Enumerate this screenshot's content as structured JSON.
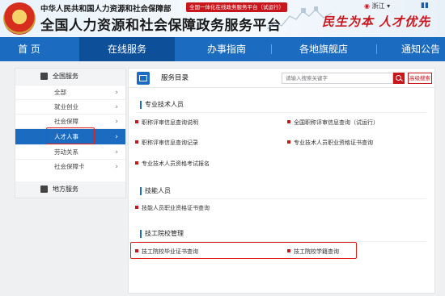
{
  "header": {
    "org_name": "中华人民共和国人力资源和社会保障部",
    "org_tag": "全国一体化在线政务服务平台（试运行）",
    "site_title": "全国人力资源和社会保障政务服务平台",
    "region": "浙江",
    "slogan": "民生为本 人才优先"
  },
  "nav": {
    "items": [
      {
        "label": "首 页"
      },
      {
        "label": "在线服务"
      },
      {
        "label": "办事指南"
      },
      {
        "label": "各地旗舰店"
      },
      {
        "label": "通知公告"
      }
    ]
  },
  "sidebar": {
    "national_label": "全国服务",
    "items": [
      {
        "label": "全部"
      },
      {
        "label": "就业创业"
      },
      {
        "label": "社会保障"
      },
      {
        "label": "人才人事"
      },
      {
        "label": "劳动关系"
      },
      {
        "label": "社会保障卡"
      }
    ],
    "active_item": "人才人事",
    "local_label": "地方服务"
  },
  "content": {
    "directory_title": "服务目录",
    "search_placeholder": "请输入搜索关键字",
    "advanced_search": "高级搜索",
    "sections": [
      {
        "title": "专业技术人员",
        "links": [
          "职称评审信息查询说明",
          "全国职称评审信息查询（试运行）",
          "职称评审信息查询记录",
          "专业技术人员职业资格证书查询",
          "专业技术人员资格考试报名"
        ]
      },
      {
        "title": "技能人员",
        "links": [
          "技能人员职业资格证书查询"
        ]
      },
      {
        "title": "技工院校管理",
        "links": [
          "技工院校毕业证书查询",
          "技工院校学籍查询"
        ]
      }
    ]
  },
  "colors": {
    "primary_blue": "#1b6cc0",
    "nav_active": "#0e4f9a",
    "accent_red": "#c8161d",
    "highlight_red": "#e0201a"
  }
}
